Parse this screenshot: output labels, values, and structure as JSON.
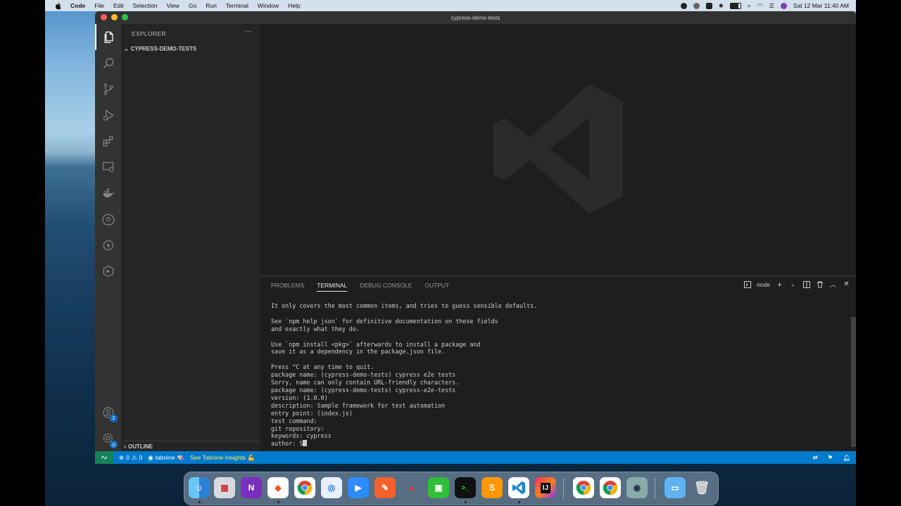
{
  "menubar": {
    "app": "Code",
    "items": [
      "File",
      "Edit",
      "Selection",
      "View",
      "Go",
      "Run",
      "Terminal",
      "Window",
      "Help"
    ],
    "clock": "Sat 12 Mar  11:40 AM"
  },
  "window": {
    "title": "cypress-demo-tests"
  },
  "sidebar": {
    "header": "EXPLORER",
    "more": "···",
    "folder": "CYPRESS-DEMO-TESTS",
    "outline": "OUTLINE"
  },
  "activity": {
    "accounts_badge": "2"
  },
  "panel": {
    "tabs": [
      "PROBLEMS",
      "TERMINAL",
      "DEBUG CONSOLE",
      "OUTPUT"
    ],
    "active_tab": "TERMINAL",
    "shell": "node",
    "terminal_lines": [
      "It only covers the most common items, and tries to guess sensible defaults.",
      "",
      "See `npm help json` for definitive documentation on these fields",
      "and exactly what they do.",
      "",
      "Use `npm install <pkg>` afterwards to install a package and",
      "save it as a dependency in the package.json file.",
      "",
      "Press ^C at any time to quit.",
      "package name: (cypress-demo-tests) cypress e2e tests",
      "Sorry, name can only contain URL-friendly characters.",
      "package name: (cypress-demo-tests) cypress-e2e-tests",
      "version: (1.0.0)",
      "description: Sample framework for test automation",
      "entry point: (index.js)",
      "test command:",
      "git repository:",
      "keywords: cypress"
    ],
    "prompt_line": "author: S"
  },
  "statusbar": {
    "errors": "0",
    "warnings": "0",
    "tabnine": "tabnine",
    "tabnine_emoji": "👒",
    "insights": "See Tabnine Insights",
    "insights_emoji": "💪"
  },
  "colors": {
    "accent": "#007acc",
    "remote": "#16825d",
    "editor_bg": "#1e1e1e",
    "sidebar_bg": "#252526",
    "activity_bg": "#333333",
    "insight_text": "#ffea70"
  },
  "dock": {
    "apps": [
      "finder-icon",
      "launchpad-icon",
      "onenote-icon",
      "brave-icon",
      "chrome-icon",
      "safari-icon",
      "zoom-icon",
      "pen-app-icon",
      "warning-app-icon",
      "facetime-icon",
      "terminal-icon",
      "sublime-icon",
      "vscode-icon",
      "intellij-icon",
      "chrome-icon",
      "chrome-icon",
      "preview-icon",
      "folder-icon",
      "trash-icon"
    ]
  }
}
